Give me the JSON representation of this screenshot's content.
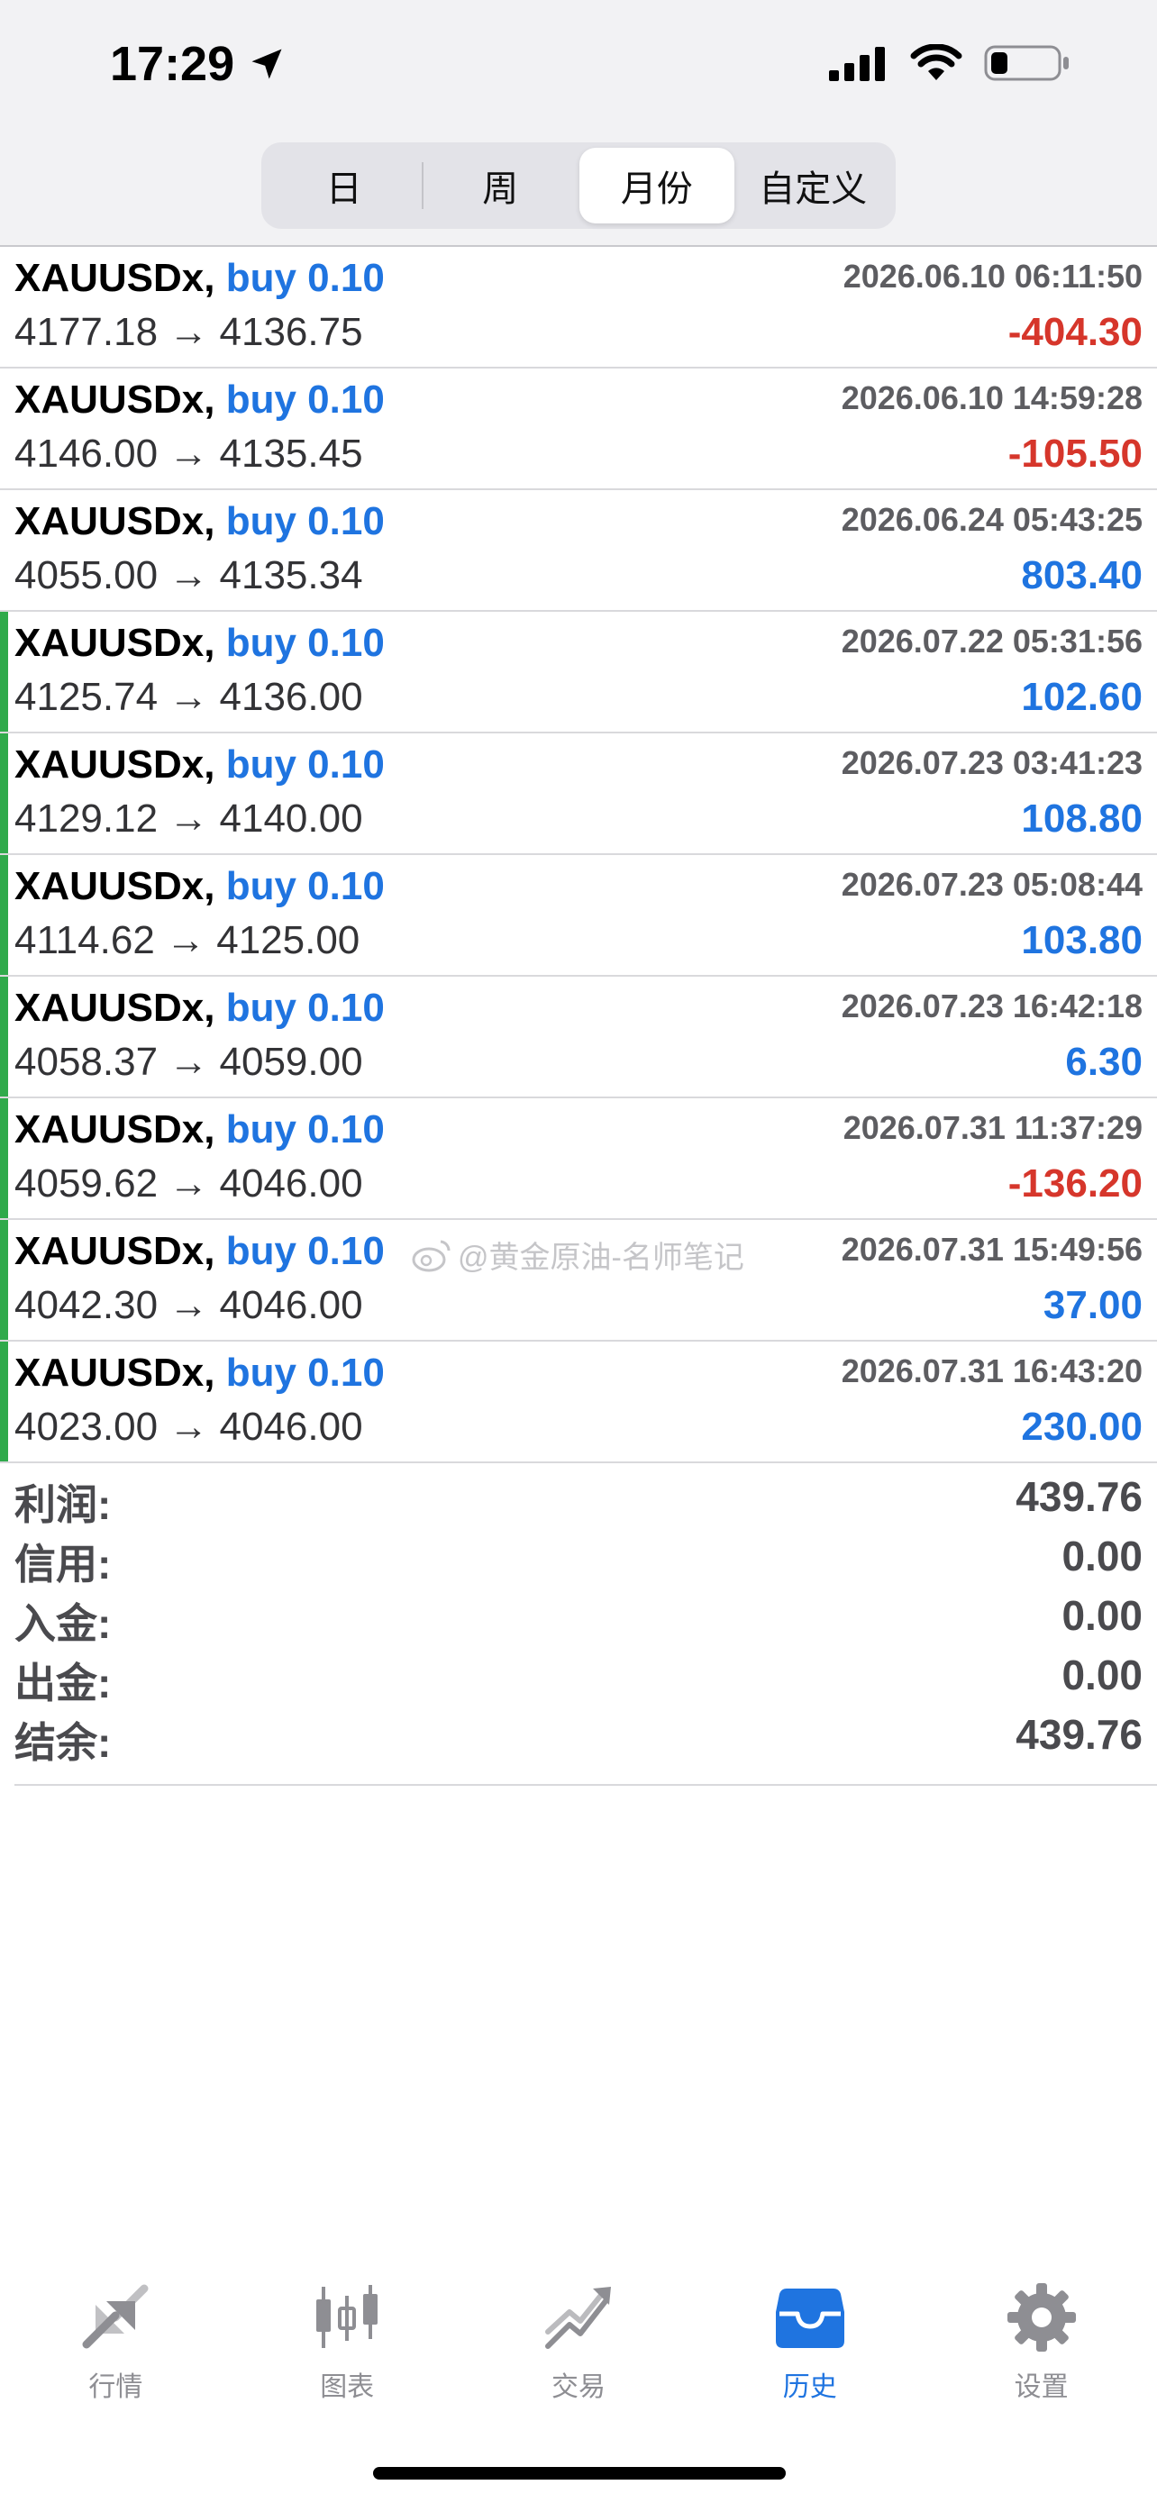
{
  "status_bar": {
    "time": "17:29"
  },
  "segments": [
    {
      "label": "日",
      "active": false
    },
    {
      "label": "周",
      "active": false
    },
    {
      "label": "月份",
      "active": true
    },
    {
      "label": "自定义",
      "active": false
    }
  ],
  "trades": [
    {
      "symbol": "XAUUSDx,",
      "side": "buy 0.10",
      "date": "2026.06.10 06:11:50",
      "prices": "4177.18 → 4136.75",
      "profit": "-404.30",
      "negative": true,
      "marked": false
    },
    {
      "symbol": "XAUUSDx,",
      "side": "buy 0.10",
      "date": "2026.06.10 14:59:28",
      "prices": "4146.00 → 4135.45",
      "profit": "-105.50",
      "negative": true,
      "marked": false
    },
    {
      "symbol": "XAUUSDx,",
      "side": "buy 0.10",
      "date": "2026.06.24 05:43:25",
      "prices": "4055.00 → 4135.34",
      "profit": "803.40",
      "negative": false,
      "marked": false
    },
    {
      "symbol": "XAUUSDx,",
      "side": "buy 0.10",
      "date": "2026.07.22 05:31:56",
      "prices": "4125.74 → 4136.00",
      "profit": "102.60",
      "negative": false,
      "marked": true
    },
    {
      "symbol": "XAUUSDx,",
      "side": "buy 0.10",
      "date": "2026.07.23 03:41:23",
      "prices": "4129.12 → 4140.00",
      "profit": "108.80",
      "negative": false,
      "marked": true
    },
    {
      "symbol": "XAUUSDx,",
      "side": "buy 0.10",
      "date": "2026.07.23 05:08:44",
      "prices": "4114.62 → 4125.00",
      "profit": "103.80",
      "negative": false,
      "marked": true
    },
    {
      "symbol": "XAUUSDx,",
      "side": "buy 0.10",
      "date": "2026.07.23 16:42:18",
      "prices": "4058.37 → 4059.00",
      "profit": "6.30",
      "negative": false,
      "marked": true
    },
    {
      "symbol": "XAUUSDx,",
      "side": "buy 0.10",
      "date": "2026.07.31 11:37:29",
      "prices": "4059.62 → 4046.00",
      "profit": "-136.20",
      "negative": true,
      "marked": true
    },
    {
      "symbol": "XAUUSDx,",
      "side": "buy 0.10",
      "date": "2026.07.31 15:49:56",
      "prices": "4042.30 → 4046.00",
      "profit": "37.00",
      "negative": false,
      "marked": true
    },
    {
      "symbol": "XAUUSDx,",
      "side": "buy 0.10",
      "date": "2026.07.31 16:43:20",
      "prices": "4023.00 → 4046.00",
      "profit": "230.00",
      "negative": false,
      "marked": true
    }
  ],
  "watermark": "@黄金原油-名师笔记",
  "summary": [
    {
      "label": "利润:",
      "value": "439.76"
    },
    {
      "label": "信用:",
      "value": "0.00"
    },
    {
      "label": "入金:",
      "value": "0.00"
    },
    {
      "label": "出金:",
      "value": "0.00"
    },
    {
      "label": "结余:",
      "value": "439.76"
    }
  ],
  "tabs": [
    {
      "label": "行情",
      "icon": "quotes-icon",
      "active": false
    },
    {
      "label": "图表",
      "icon": "candlestick-chart-icon",
      "active": false
    },
    {
      "label": "交易",
      "icon": "trade-icon",
      "active": false
    },
    {
      "label": "历史",
      "icon": "history-inbox-icon",
      "active": true
    },
    {
      "label": "设置",
      "icon": "gear-icon",
      "active": false
    }
  ],
  "colors": {
    "accent": "#1f74e0",
    "loss": "#d6362b",
    "marker": "#2faa4b",
    "inactive": "#8e8e93"
  }
}
